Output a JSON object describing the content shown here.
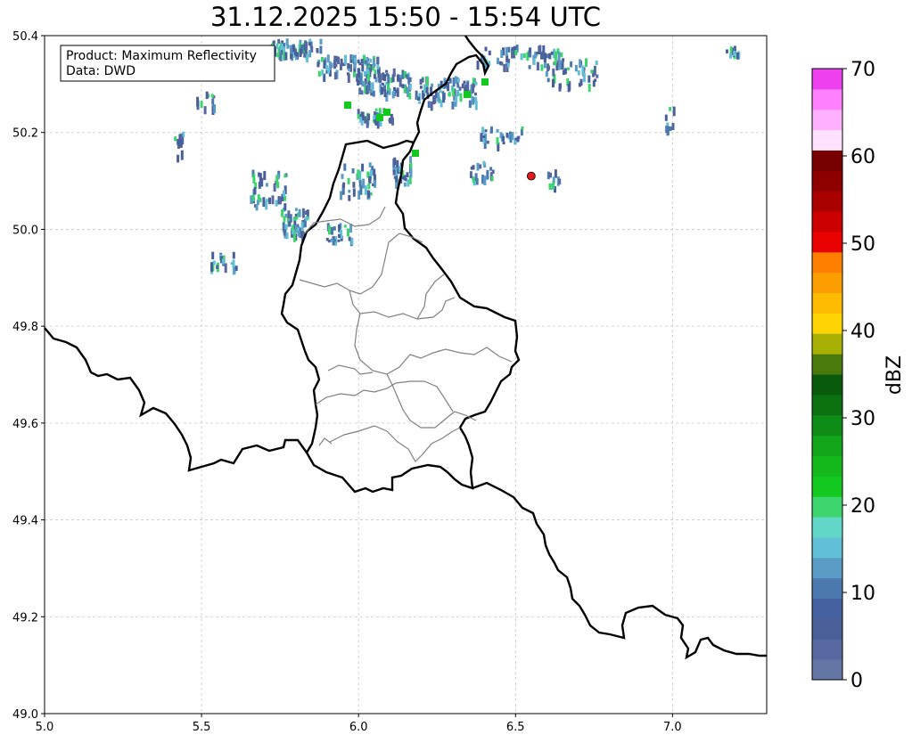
{
  "title": "31.12.2025 15:50 - 15:54 UTC",
  "info_box": {
    "product": "Product: Maximum Reflectivity",
    "data": "Data: DWD"
  },
  "map": {
    "lon_range": [
      5.0,
      7.3
    ],
    "lat_range": [
      49.0,
      50.4
    ],
    "x_ticks": [
      "5.0",
      "5.5",
      "6.0",
      "6.5",
      "7.0"
    ],
    "y_ticks": [
      "49.0",
      "49.2",
      "49.4",
      "49.6",
      "49.8",
      "50.0",
      "50.2",
      "50.4"
    ],
    "grid": true,
    "marker": {
      "lon": 6.55,
      "lat": 50.11,
      "color": "#e41a1c"
    }
  },
  "colorbar": {
    "label": "dBZ",
    "ticks": [
      "0",
      "10",
      "20",
      "30",
      "40",
      "50",
      "60",
      "70"
    ],
    "range": [
      0,
      70
    ],
    "colors": [
      "#6476a6",
      "#56689f",
      "#4a5e98",
      "#45609f",
      "#4b78ae",
      "#5a9cc6",
      "#62bfd8",
      "#62d7c7",
      "#3cd46c",
      "#13c81f",
      "#14b81b",
      "#12a419",
      "#0f8c15",
      "#0c7211",
      "#0a5a0e",
      "#4a7a0b",
      "#a8b004",
      "#fed503",
      "#feba00",
      "#fd9e00",
      "#fe7f00",
      "#e90000",
      "#cd0000",
      "#a90000",
      "#8e0000",
      "#770000",
      "#ffe0ff",
      "#ffb0ff",
      "#ff80ff",
      "#ee40ee"
    ]
  }
}
